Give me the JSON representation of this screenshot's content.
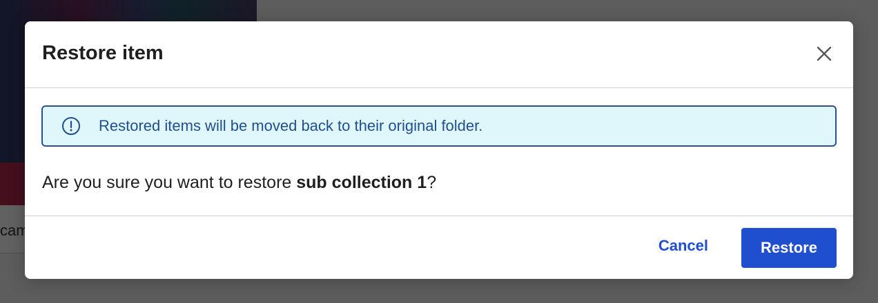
{
  "background": {
    "card_text": "cam"
  },
  "dialog": {
    "title": "Restore item",
    "close_icon": "close-icon",
    "info_icon": "info-icon",
    "info_message": "Restored items will be moved back to their original folder.",
    "confirm_prefix": "Are you sure you want to restore ",
    "item_name": "sub collection 1",
    "confirm_suffix": "?",
    "cancel_label": "Cancel",
    "restore_label": "Restore"
  },
  "colors": {
    "accent": "#1f4fcf",
    "info_bg": "#dff6fb",
    "info_border": "#2d4f8f"
  }
}
